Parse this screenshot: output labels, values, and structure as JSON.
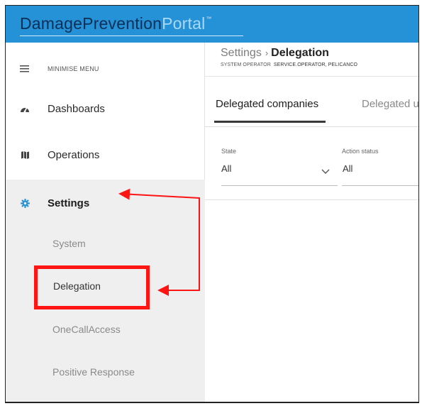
{
  "header": {
    "logo_part1": "Damage",
    "logo_part2": "Prevention",
    "logo_part3": "Portal",
    "logo_tm": "™",
    "colors": {
      "bar": "#2591d6",
      "logo_dark": "#0c2f57",
      "logo_light": "#a9d9f6"
    }
  },
  "sidebar": {
    "minimise_label": "MINIMISE MENU",
    "items": [
      {
        "label": "Dashboards",
        "icon": "gauge-icon"
      },
      {
        "label": "Operations",
        "icon": "map-icon"
      },
      {
        "label": "Settings",
        "icon": "gear-icon"
      }
    ],
    "settings_sub": [
      {
        "label": "System"
      },
      {
        "label": "Delegation"
      },
      {
        "label": "OneCallAccess"
      },
      {
        "label": "Positive Response"
      }
    ],
    "colors": {
      "active_bg": "#efefef",
      "settings_icon": "#2a93d6"
    }
  },
  "main": {
    "breadcrumb_parent": "Settings",
    "breadcrumb_separator": "›",
    "breadcrumb_current": "Delegation",
    "role_label": "SYSTEM OPERATOR",
    "role_value": "SERVICE.OPERATOR, PELICANCO",
    "tabs": [
      {
        "label": "Delegated companies"
      },
      {
        "label": "Delegated u"
      }
    ],
    "filters": [
      {
        "label": "State",
        "value": "All"
      },
      {
        "label": "Action status",
        "value": "All"
      }
    ]
  },
  "annotations": {
    "highlight_color": "#ff1414"
  }
}
